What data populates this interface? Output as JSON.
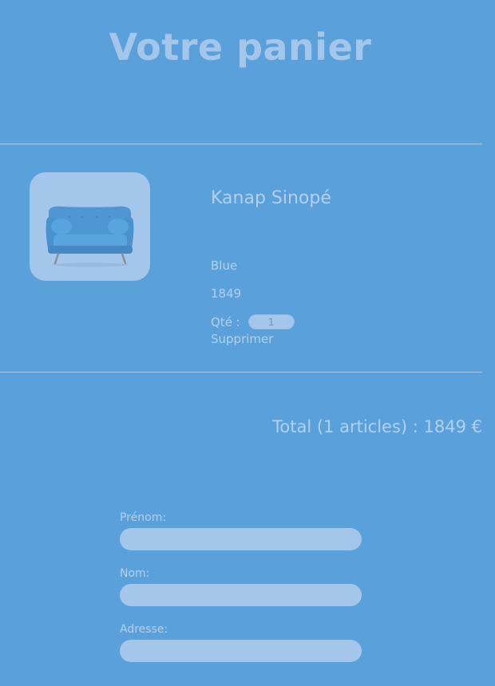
{
  "page": {
    "title": "Votre panier"
  },
  "cart": {
    "items": [
      {
        "name": "Kanap Sinopé",
        "color": "Blue",
        "price": "1849",
        "qty_label": "Qté :",
        "quantity": "1",
        "delete_label": "Supprimer",
        "image_icon": "sofa-icon"
      }
    ],
    "total_text": "Total (1 articles) : 1849 €"
  },
  "form": {
    "first_name_label": "Prénom:",
    "last_name_label": "Nom:",
    "address_label": "Adresse:",
    "first_name_value": "",
    "last_name_value": "",
    "address_value": ""
  },
  "colors": {
    "background": "#5aa1dc",
    "accent_light": "#a3c6ea",
    "text_light": "#b3d0ef"
  }
}
